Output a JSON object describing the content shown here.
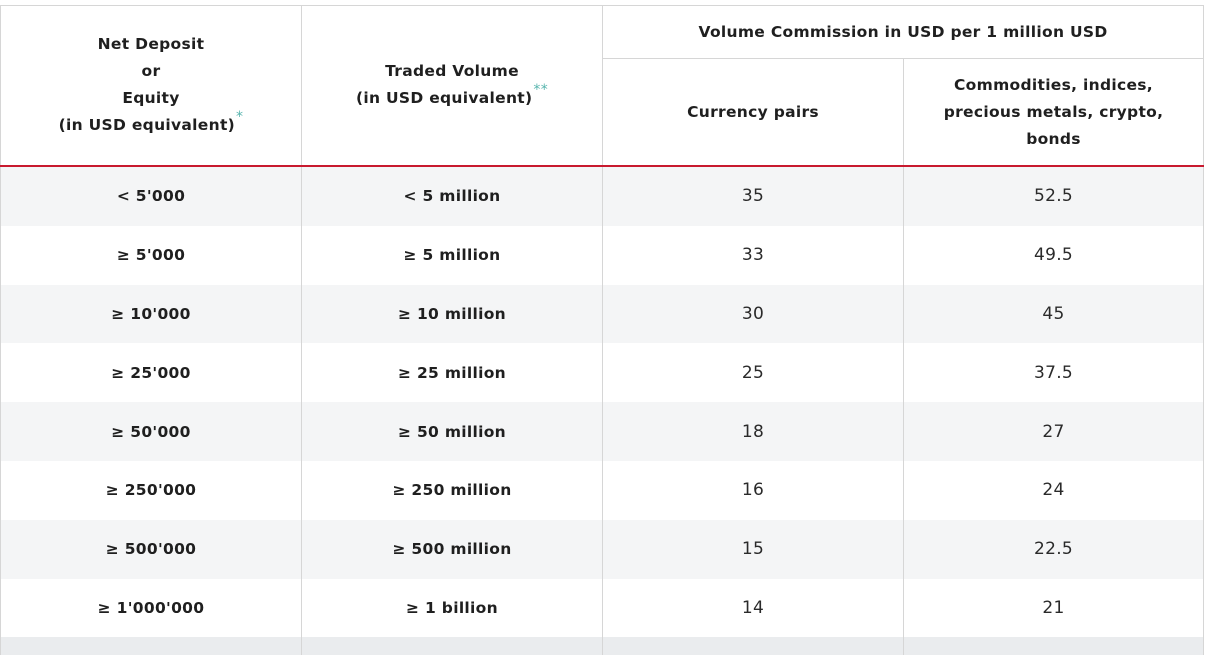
{
  "header": {
    "col1_line1": "Net Deposit",
    "col1_line2": "or",
    "col1_line3": "Equity",
    "col1_line4": "(in USD equivalent)",
    "col1_mark": "*",
    "col2_line1": "Traded Volume",
    "col2_line2": "(in USD equivalent)",
    "col2_mark": "**",
    "group": "Volume Commission in USD per 1 million USD",
    "col3": "Currency pairs",
    "col4_line1": "Commodities, indices,",
    "col4_line2": "precious metals, crypto,",
    "col4_line3": "bonds"
  },
  "rows": [
    {
      "deposit": "< 5'000",
      "volume": "< 5 million",
      "currency": "35",
      "commodities": "52.5"
    },
    {
      "deposit": "≥ 5'000",
      "volume": "≥ 5 million",
      "currency": "33",
      "commodities": "49.5"
    },
    {
      "deposit": "≥ 10'000",
      "volume": "≥ 10 million",
      "currency": "30",
      "commodities": "45"
    },
    {
      "deposit": "≥ 25'000",
      "volume": "≥ 25 million",
      "currency": "25",
      "commodities": "37.5"
    },
    {
      "deposit": "≥ 50'000",
      "volume": "≥ 50 million",
      "currency": "18",
      "commodities": "27"
    },
    {
      "deposit": "≥ 250'000",
      "volume": "≥ 250 million",
      "currency": "16",
      "commodities": "24"
    },
    {
      "deposit": "≥ 500'000",
      "volume": "≥ 500 million",
      "currency": "15",
      "commodities": "22.5"
    },
    {
      "deposit": "≥ 1'000'000",
      "volume": "≥ 1 billion",
      "currency": "14",
      "commodities": "21"
    }
  ],
  "colors": {
    "header_rule": "#c8192e",
    "asterisk": "#56b4ad",
    "stripe": "#f4f5f6"
  }
}
